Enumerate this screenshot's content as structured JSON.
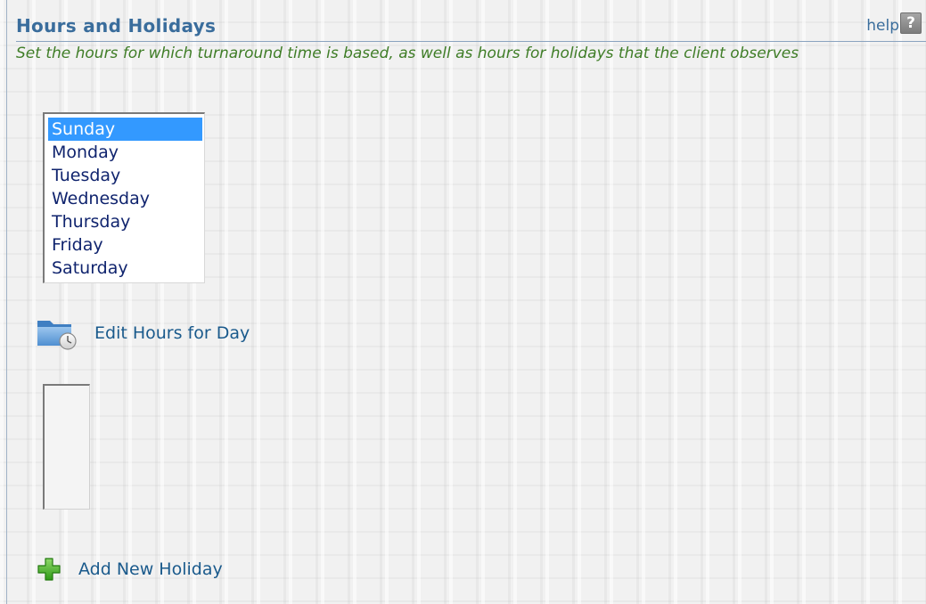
{
  "header": {
    "title": "Hours and Holidays",
    "help_label": "help",
    "help_icon_glyph": "?"
  },
  "description": "Set the hours for which turnaround time is based, as well as hours for holidays that the client observes",
  "days": {
    "selected": "Sunday",
    "options": [
      "Sunday",
      "Monday",
      "Tuesday",
      "Wednesday",
      "Thursday",
      "Friday",
      "Saturday"
    ]
  },
  "actions": {
    "edit_hours_label": "Edit Hours for Day",
    "edit_hours_icon": "folder-clock-icon",
    "add_holiday_label": "Add New Holiday",
    "add_holiday_icon": "green-plus-icon"
  },
  "holidays": {
    "items": []
  },
  "colors": {
    "title": "#3a6d9c",
    "description": "#3f7d27",
    "link": "#1a5a8c",
    "selection": "#3399ff",
    "list_text": "#10246e"
  }
}
